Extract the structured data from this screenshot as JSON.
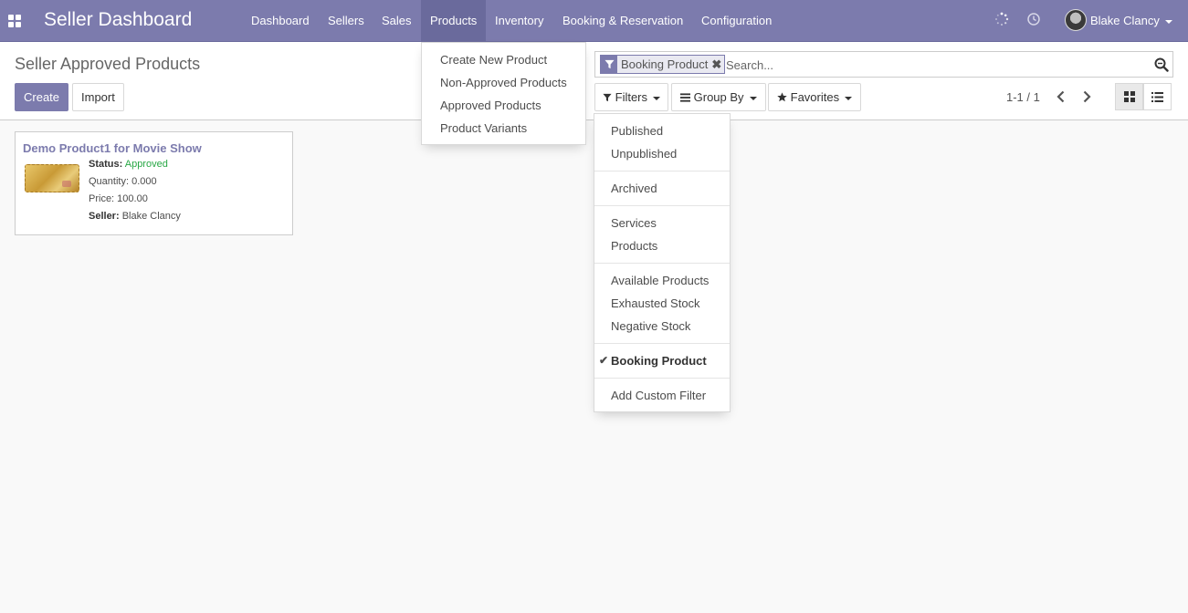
{
  "navbar": {
    "app_title": "Seller Dashboard",
    "menu": [
      "Dashboard",
      "Sellers",
      "Sales",
      "Products",
      "Inventory",
      "Booking & Reservation",
      "Configuration"
    ],
    "active_menu": "Products",
    "user_name": "Blake Clancy",
    "icons": [
      "apps-grid-icon",
      "activity-spinner-icon",
      "clock-icon"
    ]
  },
  "products_menu": {
    "items": [
      "Create New Product",
      "Non-Approved Products",
      "Approved Products",
      "Product Variants"
    ]
  },
  "control_panel": {
    "page_title": "Seller Approved Products",
    "create_label": "Create",
    "import_label": "Import",
    "search": {
      "facet_label": "Booking Product",
      "facet_remove": "✖",
      "placeholder": "Search..."
    },
    "filters_label": "Filters",
    "group_by_label": "Group By",
    "favorites_label": "Favorites",
    "pager_text": "1-1 / 1"
  },
  "filters_menu": {
    "groups": [
      [
        "Published",
        "Unpublished"
      ],
      [
        "Archived"
      ],
      [
        "Services",
        "Products"
      ],
      [
        "Available Products",
        "Exhausted Stock",
        "Negative Stock"
      ],
      [
        "Booking Product"
      ],
      [
        "Add Custom Filter"
      ]
    ],
    "selected": "Booking Product"
  },
  "kanban": {
    "records": [
      {
        "name": "Demo Product1 for Movie Show",
        "status_label": "Status:",
        "status_value": "Approved",
        "quantity": "Quantity: 0.000",
        "price": "Price: 100.00",
        "seller_label": "Seller:",
        "seller_value": "Blake Clancy"
      }
    ]
  },
  "colors": {
    "brand": "#7c7bad",
    "brand_dark": "#6a6a9c",
    "approved": "#28a745"
  }
}
